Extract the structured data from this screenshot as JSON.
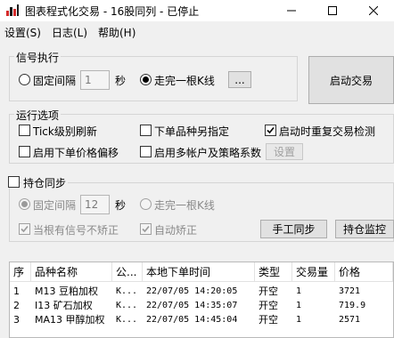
{
  "window": {
    "title": "图表程式化交易 - 16股同列 - 已停止",
    "icon": "app-icon",
    "controls": {
      "minimize": "minimize-icon",
      "maximize": "maximize-icon",
      "close": "close-icon"
    }
  },
  "menu": [
    "设置(S)",
    "日志(L)",
    "帮助(H)"
  ],
  "signal": {
    "group_title": "信号执行",
    "fixed_interval_label": "固定间隔",
    "interval_value": "1",
    "seconds_label": "秒",
    "bar_complete_label": "走完一根K线",
    "ellipsis_label": "...",
    "selected": "bar_complete"
  },
  "start_button": "启动交易",
  "options": {
    "group_title": "运行选项",
    "tick_refresh": {
      "label": "Tick级别刷新",
      "checked": false
    },
    "separate_order": {
      "label": "下单品种另指定",
      "checked": false
    },
    "startup_recheck": {
      "label": "启动时重复交易检测",
      "checked": true
    },
    "price_offset": {
      "label": "启用下单价格偏移",
      "checked": false
    },
    "multi_account": {
      "label": "启用多帐户及策略系数",
      "checked": false
    },
    "settings_button": "设置"
  },
  "position_sync": {
    "title": "持仓同步",
    "enabled": false,
    "fixed_interval_label": "固定间隔",
    "interval_value": "12",
    "seconds_label": "秒",
    "bar_complete_label": "走完一根K线",
    "selected": "fixed_interval",
    "only_on_signal": {
      "label": "当根有信号不矫正",
      "checked": true
    },
    "auto_correct": {
      "label": "自动矫正",
      "checked": true
    },
    "manual_sync_button": "手工同步",
    "position_monitor_button": "持仓监控"
  },
  "table": {
    "headers": [
      "序",
      "品种名称",
      "公...",
      "本地下单时间",
      "类型",
      "交易量",
      "价格"
    ],
    "rows": [
      [
        "1",
        "M13 豆粕加权",
        "K...",
        "22/07/05 14:20:05",
        "开空",
        "1",
        "3721"
      ],
      [
        "2",
        "I13 矿石加权",
        "K...",
        "22/07/05 14:35:07",
        "开空",
        "1",
        "719.9"
      ],
      [
        "3",
        "MA13 甲醇加权",
        "K...",
        "22/07/05 14:45:04",
        "开空",
        "1",
        "2571"
      ]
    ]
  },
  "colors": {
    "background": "#f0f0f0",
    "titlebar": "#ffffff",
    "accent_icon": "#d42a2a"
  }
}
